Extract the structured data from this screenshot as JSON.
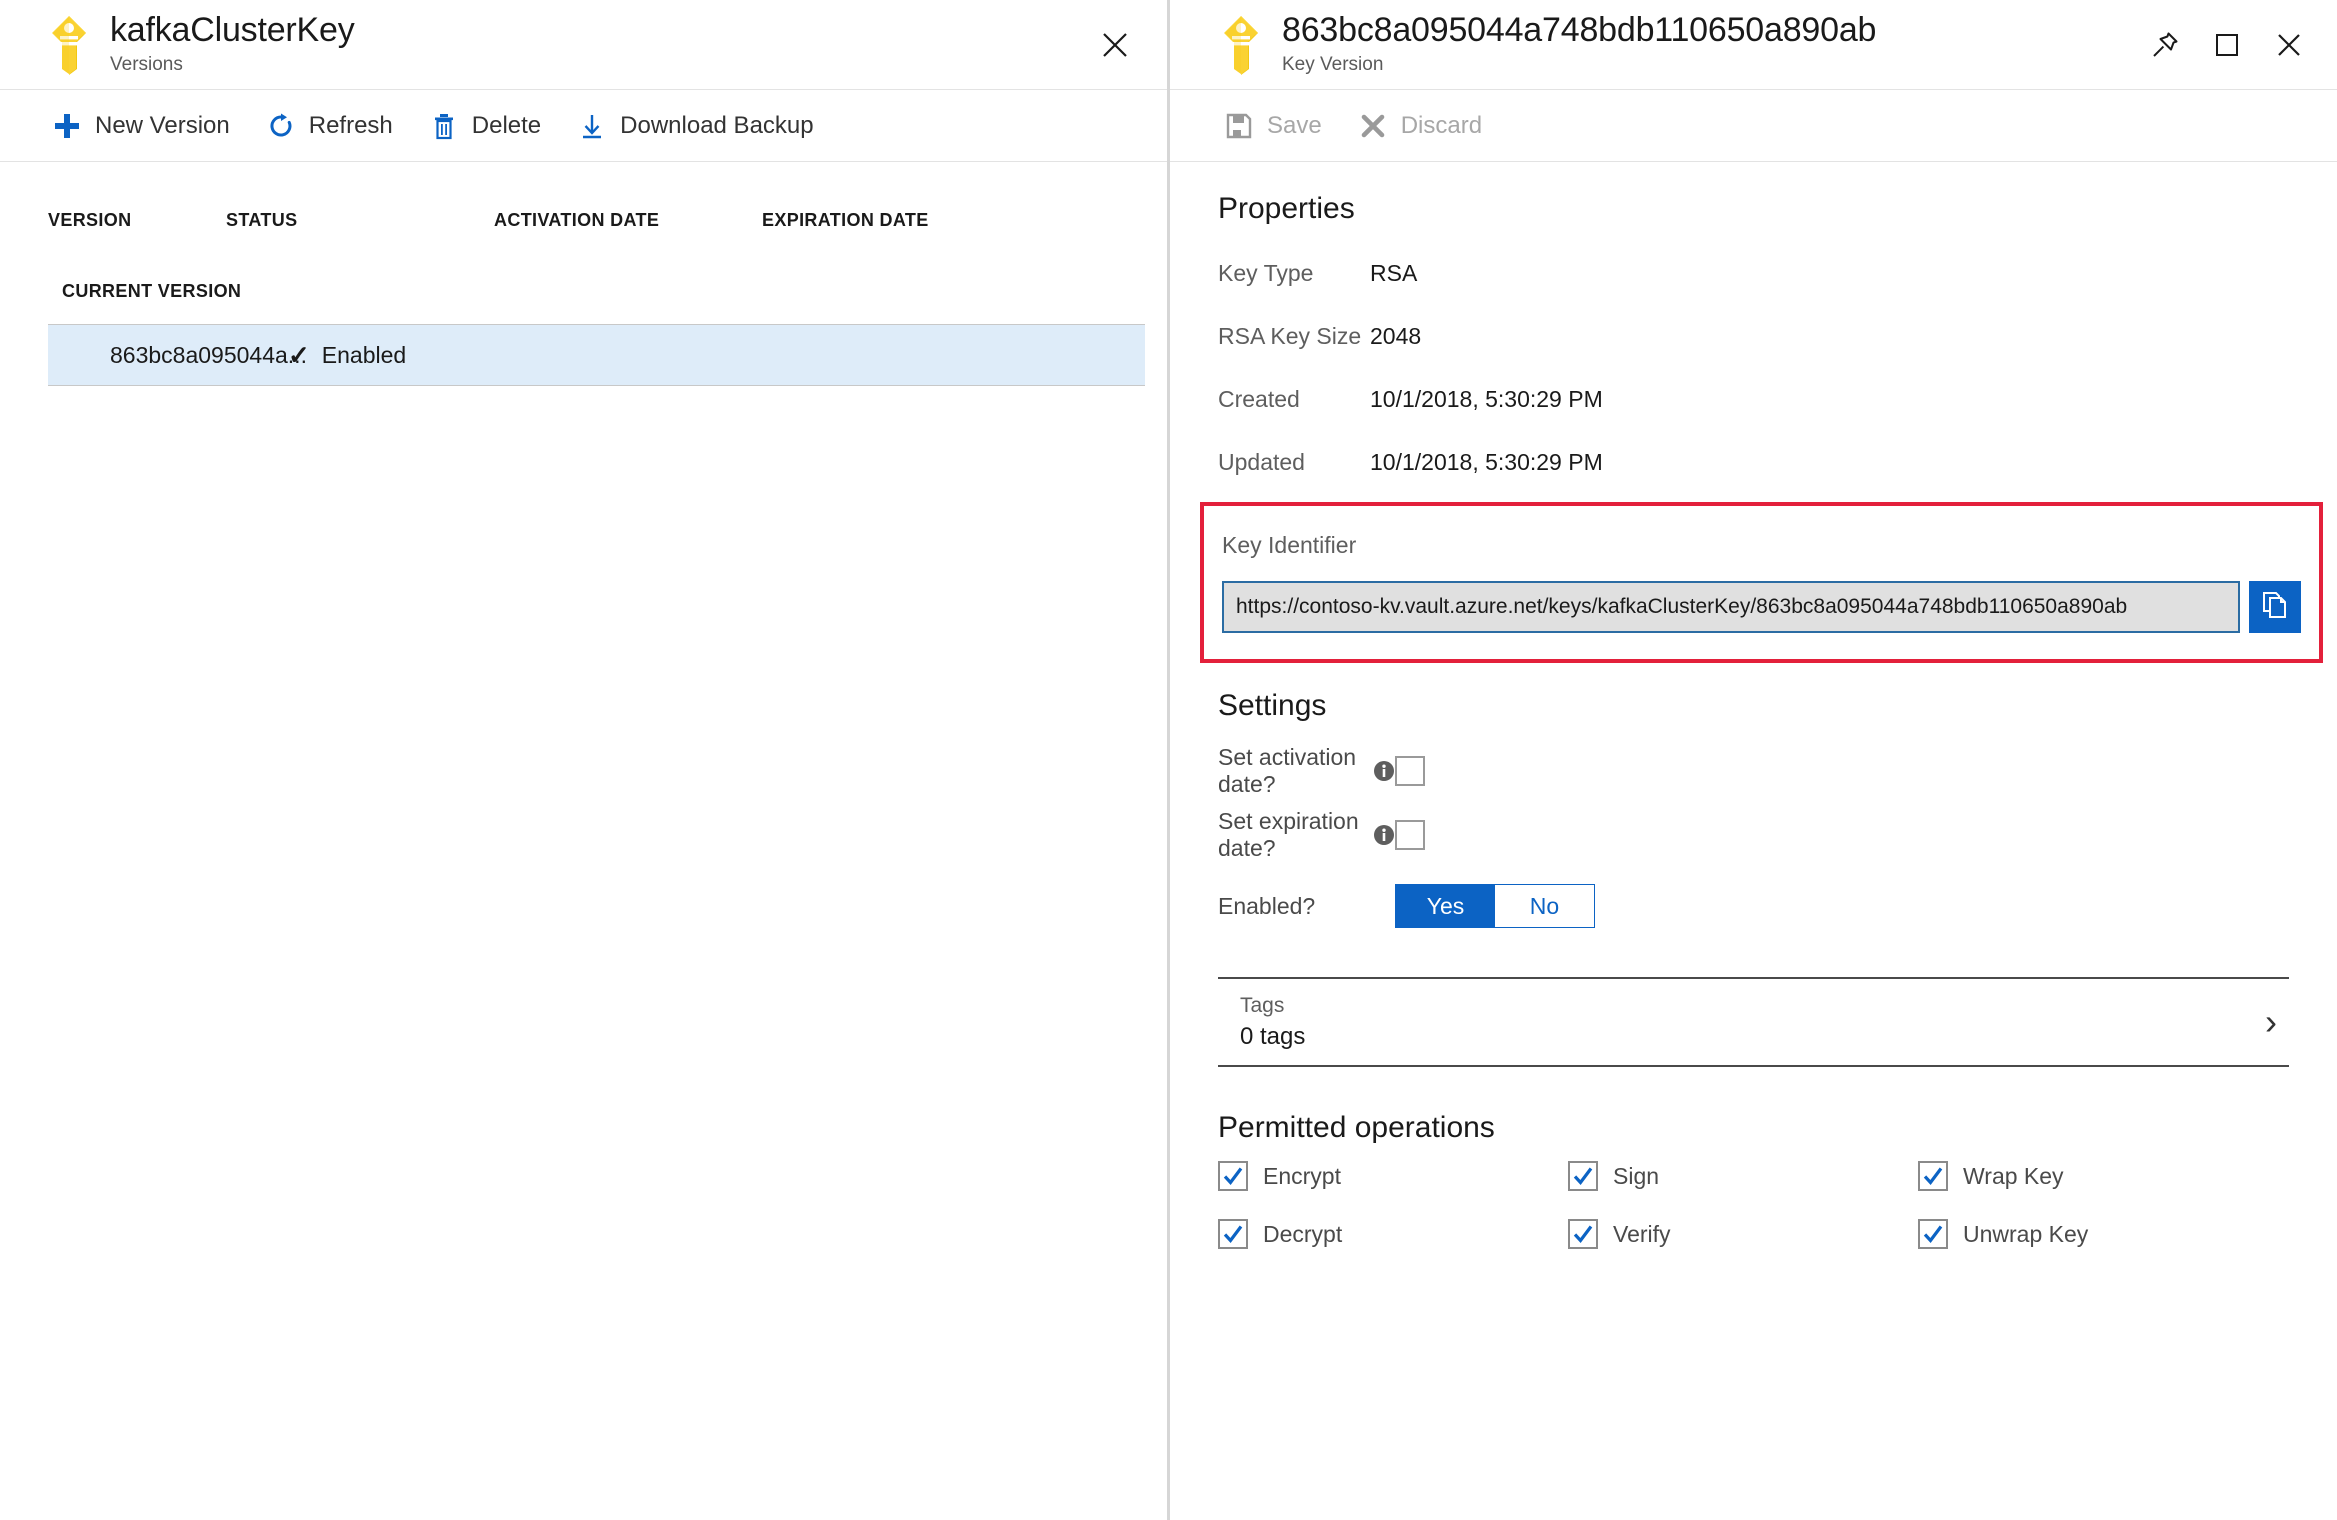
{
  "left_blade": {
    "title": "kafkaClusterKey",
    "subtitle": "Versions",
    "icon": "key-icon",
    "close_icon": "close-icon",
    "toolbar": [
      {
        "label": "New Version",
        "icon": "plus-icon"
      },
      {
        "label": "Refresh",
        "icon": "refresh-icon"
      },
      {
        "label": "Delete",
        "icon": "trash-icon"
      },
      {
        "label": "Download Backup",
        "icon": "download-icon"
      }
    ],
    "table": {
      "columns": [
        "VERSION",
        "STATUS",
        "ACTIVATION DATE",
        "EXPIRATION DATE"
      ],
      "group_label": "CURRENT VERSION",
      "rows": [
        {
          "version": "863bc8a095044a...",
          "status": "Enabled",
          "status_icon": "checkmark-icon",
          "activation_date": "",
          "expiration_date": "",
          "selected": true
        }
      ]
    }
  },
  "right_blade": {
    "title": "863bc8a095044a748bdb110650a890ab",
    "subtitle": "Key Version",
    "icon": "key-icon",
    "window_controls": [
      {
        "name": "pin-icon"
      },
      {
        "name": "maximize-icon"
      },
      {
        "name": "close-icon"
      }
    ],
    "toolbar": [
      {
        "label": "Save",
        "icon": "save-icon",
        "disabled": true
      },
      {
        "label": "Discard",
        "icon": "discard-x-icon",
        "disabled": true
      }
    ],
    "properties": {
      "heading": "Properties",
      "rows": [
        {
          "label": "Key Type",
          "value": "RSA"
        },
        {
          "label": "RSA Key Size",
          "value": "2048"
        },
        {
          "label": "Created",
          "value": "10/1/2018, 5:30:29 PM"
        },
        {
          "label": "Updated",
          "value": "10/1/2018, 5:30:29 PM"
        }
      ]
    },
    "key_identifier": {
      "label": "Key Identifier",
      "value": "https://contoso-kv.vault.azure.net/keys/kafkaClusterKey/863bc8a095044a748bdb110650a890ab",
      "copy_icon": "copy-icon",
      "highlight_color": "#e3203b"
    },
    "settings": {
      "heading": "Settings",
      "activation": {
        "label": "Set activation date?",
        "info_icon": "info-icon",
        "checked": false
      },
      "expiration": {
        "label": "Set expiration date?",
        "info_icon": "info-icon",
        "checked": false
      },
      "enabled": {
        "label": "Enabled?",
        "yes_label": "Yes",
        "no_label": "No",
        "selected": "Yes"
      }
    },
    "tags": {
      "label": "Tags",
      "value": "0 tags",
      "chevron_icon": "chevron-right-icon"
    },
    "permitted_operations": {
      "heading": "Permitted operations",
      "items": [
        {
          "label": "Encrypt",
          "checked": true
        },
        {
          "label": "Sign",
          "checked": true
        },
        {
          "label": "Wrap Key",
          "checked": true
        },
        {
          "label": "Decrypt",
          "checked": true
        },
        {
          "label": "Verify",
          "checked": true
        },
        {
          "label": "Unwrap Key",
          "checked": true
        }
      ]
    }
  },
  "colors": {
    "azure_blue": "#0c63c4",
    "key_yellow": "#f9d52c",
    "selected_row": "#deecf9",
    "highlight_red": "#e3203b"
  }
}
